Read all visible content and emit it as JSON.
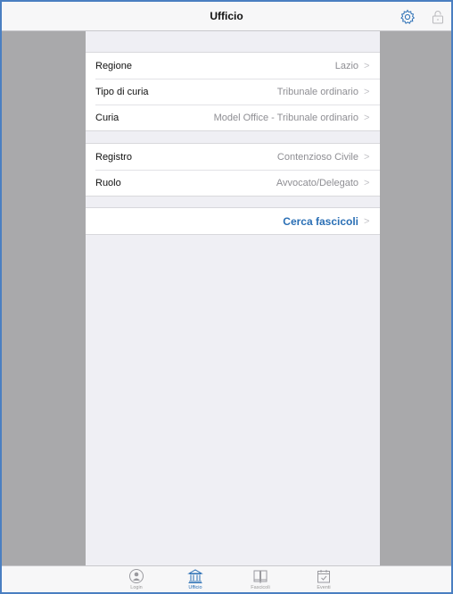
{
  "navbar": {
    "title": "Ufficio",
    "left_icon": "gear-icon",
    "right_icon": "lock-icon"
  },
  "sections": {
    "location": [
      {
        "label": "Regione",
        "value": "Lazio"
      },
      {
        "label": "Tipo di curia",
        "value": "Tribunale ordinario"
      },
      {
        "label": "Curia",
        "value": "Model Office - Tribunale ordinario"
      }
    ],
    "register": [
      {
        "label": "Registro",
        "value": "Contenzioso Civile"
      },
      {
        "label": "Ruolo",
        "value": "Avvocato/Delegato"
      }
    ],
    "action": {
      "label": "Cerca fascicoli"
    }
  },
  "chevron": ">",
  "tabbar": {
    "tabs": [
      {
        "label": "Login",
        "icon": "person-icon"
      },
      {
        "label": "Ufficio",
        "icon": "courthouse-icon"
      },
      {
        "label": "Fascicoli",
        "icon": "folder-book-icon"
      },
      {
        "label": "Eventi",
        "icon": "calendar-icon"
      }
    ],
    "active_index": 1
  },
  "colors": {
    "accent": "#2a6fb5",
    "border_frame": "#4a7fc1",
    "side_gray": "#a9a9ab"
  }
}
